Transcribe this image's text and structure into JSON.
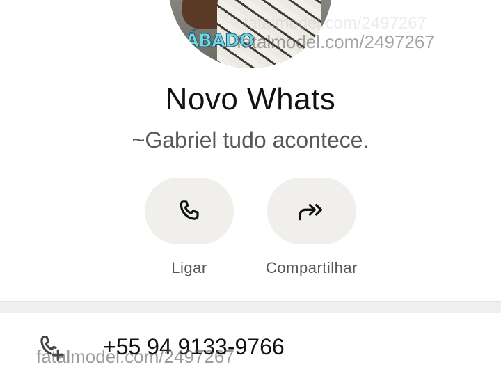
{
  "profile": {
    "photo_sticker_text": "ÁBADO",
    "name": "Novo Whats",
    "status": "~Gabriel tudo acontece."
  },
  "actions": {
    "call": {
      "icon": "phone-icon",
      "label": "Ligar"
    },
    "share": {
      "icon": "forward-icon",
      "label": "Compartilhar"
    }
  },
  "phone": {
    "icon": "phone-plus-icon",
    "number": "+55 94 9133-9766"
  },
  "watermark": {
    "top_text": "fatalmodel.com/2497267",
    "top_faint_text": "fatalmodel.com/2497267",
    "bottom_text": "fatalmodel.com/2497267"
  },
  "colors": {
    "button_bg": "#f0efec",
    "text_primary": "#111111",
    "text_secondary": "#54595e"
  }
}
